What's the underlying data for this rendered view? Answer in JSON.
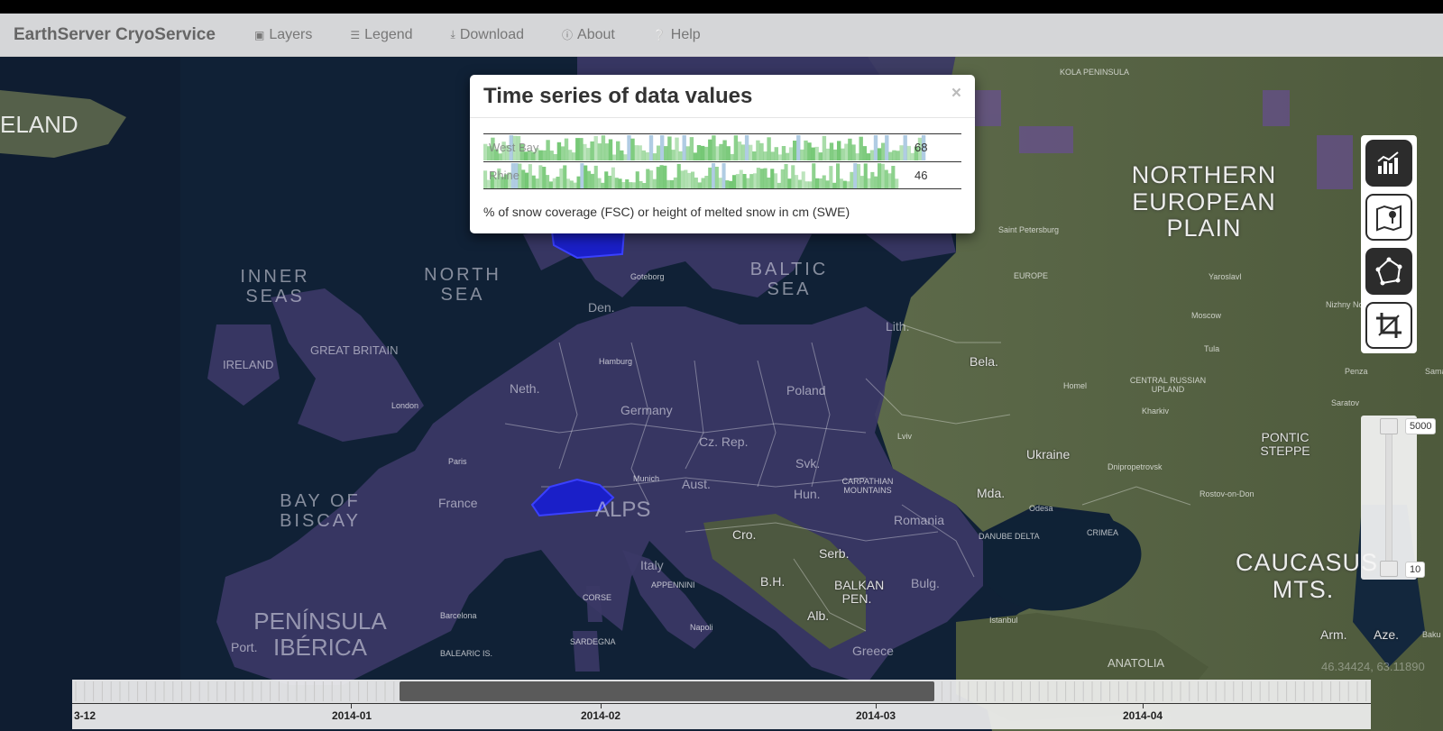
{
  "navbar": {
    "brand": "EarthServer CryoService",
    "items": [
      {
        "label": "Layers",
        "icon": "image-icon"
      },
      {
        "label": "Legend",
        "icon": "list-icon"
      },
      {
        "label": "Download",
        "icon": "download-icon"
      },
      {
        "label": "About",
        "icon": "info-icon"
      },
      {
        "label": "Help",
        "icon": "question-icon"
      }
    ]
  },
  "modal": {
    "title": "Time series of data values",
    "close": "×",
    "series": [
      {
        "name": "West Bay",
        "value": "68"
      },
      {
        "name": "Rhine",
        "value": "46"
      }
    ],
    "note": "% of snow coverage (FSC) or height of melted snow in cm (SWE)"
  },
  "map_labels": {
    "iceland": "ELAND",
    "inner_seas": "INNER SEAS",
    "north_sea": "NORTH SEA",
    "baltic_sea": "BALTIC SEA",
    "bay_of_biscay": "BAY OF BISCAY",
    "peninsula_iberica": "PENÍNSULA IBÉRICA",
    "alps": "ALPS",
    "northern_european_plain": "NORTHERN EUROPEAN PLAIN",
    "caucasus": "CAUCASUS MTS.",
    "pontic_steppe": "PONTIC STEPPE",
    "kola": "KOLA PENINSULA",
    "central_russian_upland": "CENTRAL RUSSIAN UPLAND",
    "carpathian": "CARPATHIAN MOUNTAINS",
    "danube_delta": "DANUBE DELTA",
    "crimea": "CRIMEA",
    "anatolia": "ANATOLIA",
    "europe": "EUROPE",
    "balkan": "BALKAN PEN.",
    "appennini": "APPENNINI",
    "countries": {
      "great_britain": "GREAT BRITAIN",
      "ireland": "IRELAND",
      "den": "Den.",
      "neth": "Neth.",
      "germany": "Germany",
      "poland": "Poland",
      "lith": "Lith.",
      "bela": "Bela.",
      "ukraine": "Ukraine",
      "france": "France",
      "cz": "Cz. Rep.",
      "svk": "Svk.",
      "aust": "Aust.",
      "hun": "Hun.",
      "mda": "Mda.",
      "romania": "Romania",
      "cro": "Cro.",
      "bh": "B.H.",
      "serb": "Serb.",
      "bulg": "Bulg.",
      "alb": "Alb.",
      "italy": "Italy",
      "greece": "Greece",
      "arm": "Arm.",
      "aze": "Aze.",
      "port": "Port."
    },
    "cities": {
      "saint_petersburg": "Saint Petersburg",
      "moscow": "Moscow",
      "yaroslavl": "Yaroslavl",
      "nizhny": "Nizhny Novgorod",
      "tula": "Tula",
      "penza": "Penza",
      "saratov": "Saratov",
      "homel": "Homel",
      "kharkiv": "Kharkiv",
      "dnipro": "Dnipropetrovsk",
      "rostov": "Rostov-on-Don",
      "odesa": "Odesa",
      "istanbul": "Istanbul",
      "lviv": "Lviv",
      "goteborg": "Goteborg",
      "hamburg": "Hamburg",
      "london": "London",
      "paris": "Paris",
      "munich": "Munich",
      "napoli": "Napoli",
      "barcelona": "Barcelona",
      "corse": "CORSE",
      "sardegna": "SARDEGNA",
      "balearic": "BALEARIC IS.",
      "baku": "Baku",
      "sama": "Sama"
    }
  },
  "slider": {
    "max_label": "5000",
    "min_label": "10"
  },
  "coords": "46.34424, 63.11890",
  "timeline": {
    "start_label": "3-12",
    "labels": [
      "2014-01",
      "2014-02",
      "2014-03",
      "2014-04"
    ]
  },
  "colors": {
    "navbar_bg": "#e4e4e4",
    "map_overlay": "#3d3a66",
    "highlight": "#1a1fc8",
    "spark_green": "#6cc46c",
    "spark_blue": "#a7c6e0"
  }
}
